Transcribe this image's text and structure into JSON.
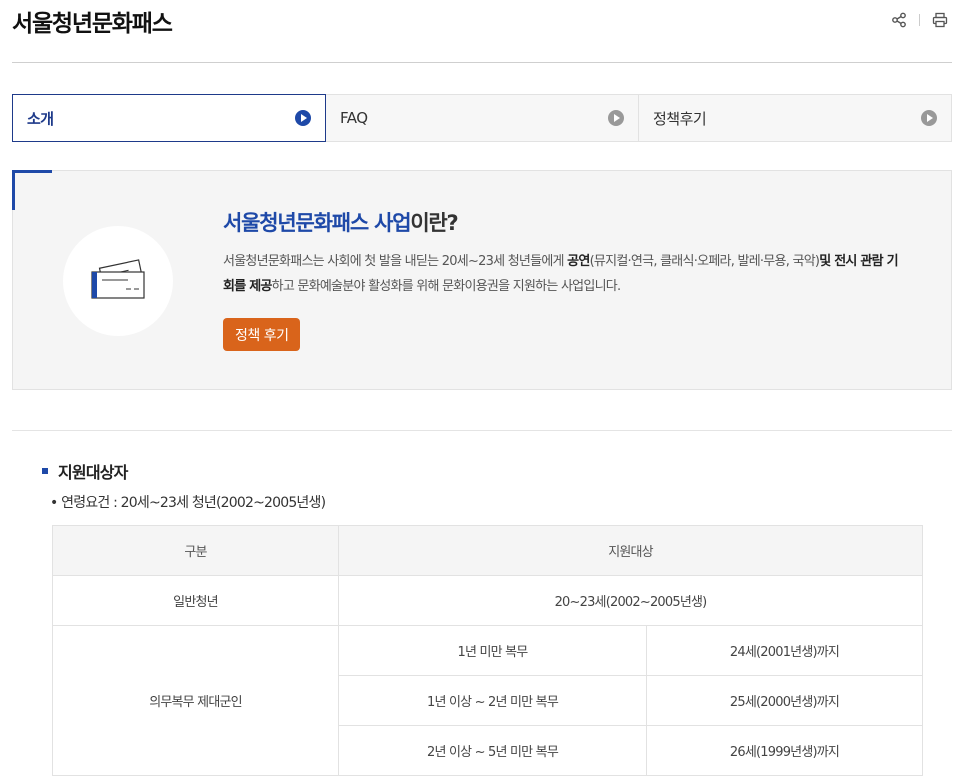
{
  "page": {
    "title": "서울청년문화패스",
    "actions": [
      {
        "icon": "share-icon"
      },
      {
        "icon": "print-icon"
      }
    ]
  },
  "tabs": [
    {
      "label": "소개",
      "active": true
    },
    {
      "label": "FAQ",
      "active": false
    },
    {
      "label": "정책후기",
      "active": false
    }
  ],
  "intro": {
    "heading_highlight": "서울청년문화패스 사업",
    "heading_rest": "이란?",
    "desc_1": "서울청년문화패스는 사회에 첫 발을 내딛는 20세~23세 청년들에게 ",
    "desc_bold_1": "공연",
    "desc_2": "(뮤지컬·연극, 클래식·오페라, 발레·무용, 국악)",
    "desc_bold_2": "및 전시 관람 기회를 제공",
    "desc_3": "하고 문화예술분야 활성화를 위해 문화이용권을 지원하는 사업입니다.",
    "cta_label": "정책 후기",
    "icon": "ticket-icon",
    "accent_color": "#1e49a8",
    "cta_color": "#d9641b"
  },
  "eligibility": {
    "section_title": "지원대상자",
    "age_requirement": "• 연령요건 : 20세~23세 청년(2002~2005년생)",
    "table": {
      "headers": [
        "구분",
        "지원대상"
      ],
      "general": {
        "category": "일반청년",
        "target": "20~23세(2002~2005년생)"
      },
      "military": {
        "category": "의무복무 제대군인",
        "rows": [
          {
            "service": "1년 미만 복무",
            "age": "24세(2001년생)까지"
          },
          {
            "service": "1년 이상 ~ 2년 미만 복무",
            "age": "25세(2000년생)까지"
          },
          {
            "service": "2년 이상 ~ 5년 미만 복무",
            "age": "26세(1999년생)까지"
          }
        ]
      }
    }
  }
}
